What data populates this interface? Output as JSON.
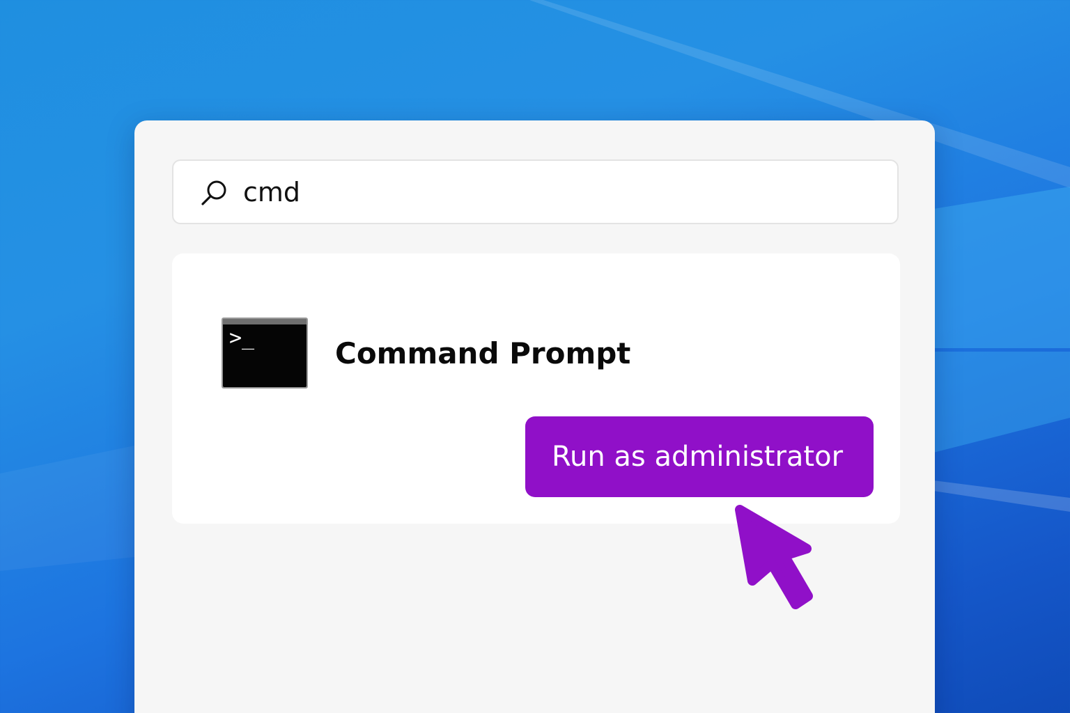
{
  "search": {
    "query": "cmd",
    "icon": "search-icon"
  },
  "result": {
    "app_name": "Command Prompt",
    "icon": "terminal-icon",
    "icon_glyph": ">_"
  },
  "action": {
    "run_admin_label": "Run as administrator"
  },
  "cursor": {
    "icon": "pointer-arrow-icon"
  },
  "colors": {
    "accent": "#9010c8",
    "panel": "#f6f6f6",
    "card": "#ffffff",
    "desktop": "#1f8fe0"
  }
}
